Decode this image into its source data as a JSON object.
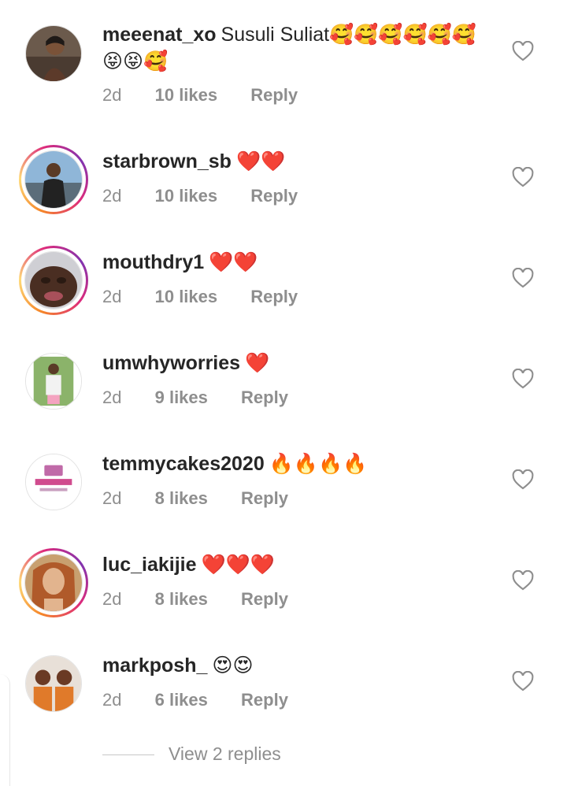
{
  "comments": [
    {
      "username": "meeenat_xo",
      "text": "Susuli Suliat🥰🥰🥰🥰🥰🥰😝😝🥰",
      "time": "2d",
      "likes": "10 likes",
      "reply": "Reply"
    },
    {
      "username": "starbrown_sb",
      "text": "❤️❤️",
      "time": "2d",
      "likes": "10 likes",
      "reply": "Reply"
    },
    {
      "username": "mouthdry1",
      "text": "❤️❤️",
      "time": "2d",
      "likes": "10 likes",
      "reply": "Reply"
    },
    {
      "username": "umwhyworries",
      "text": "❤️",
      "time": "2d",
      "likes": "9 likes",
      "reply": "Reply"
    },
    {
      "username": "temmycakes2020",
      "text": "🔥🔥🔥🔥",
      "time": "2d",
      "likes": "8 likes",
      "reply": "Reply"
    },
    {
      "username": "luc_iakijie",
      "text": "❤️❤️❤️",
      "time": "2d",
      "likes": "8 likes",
      "reply": "Reply"
    },
    {
      "username": "markposh_",
      "text": "😍😍",
      "time": "2d",
      "likes": "6 likes",
      "reply": "Reply"
    }
  ],
  "view_replies": "View 2 replies",
  "icons": {
    "like": "heart-outline-icon"
  },
  "colors": {
    "text": "#262626",
    "meta": "#8e8e8e",
    "story_ring": "#dd2a7b"
  }
}
